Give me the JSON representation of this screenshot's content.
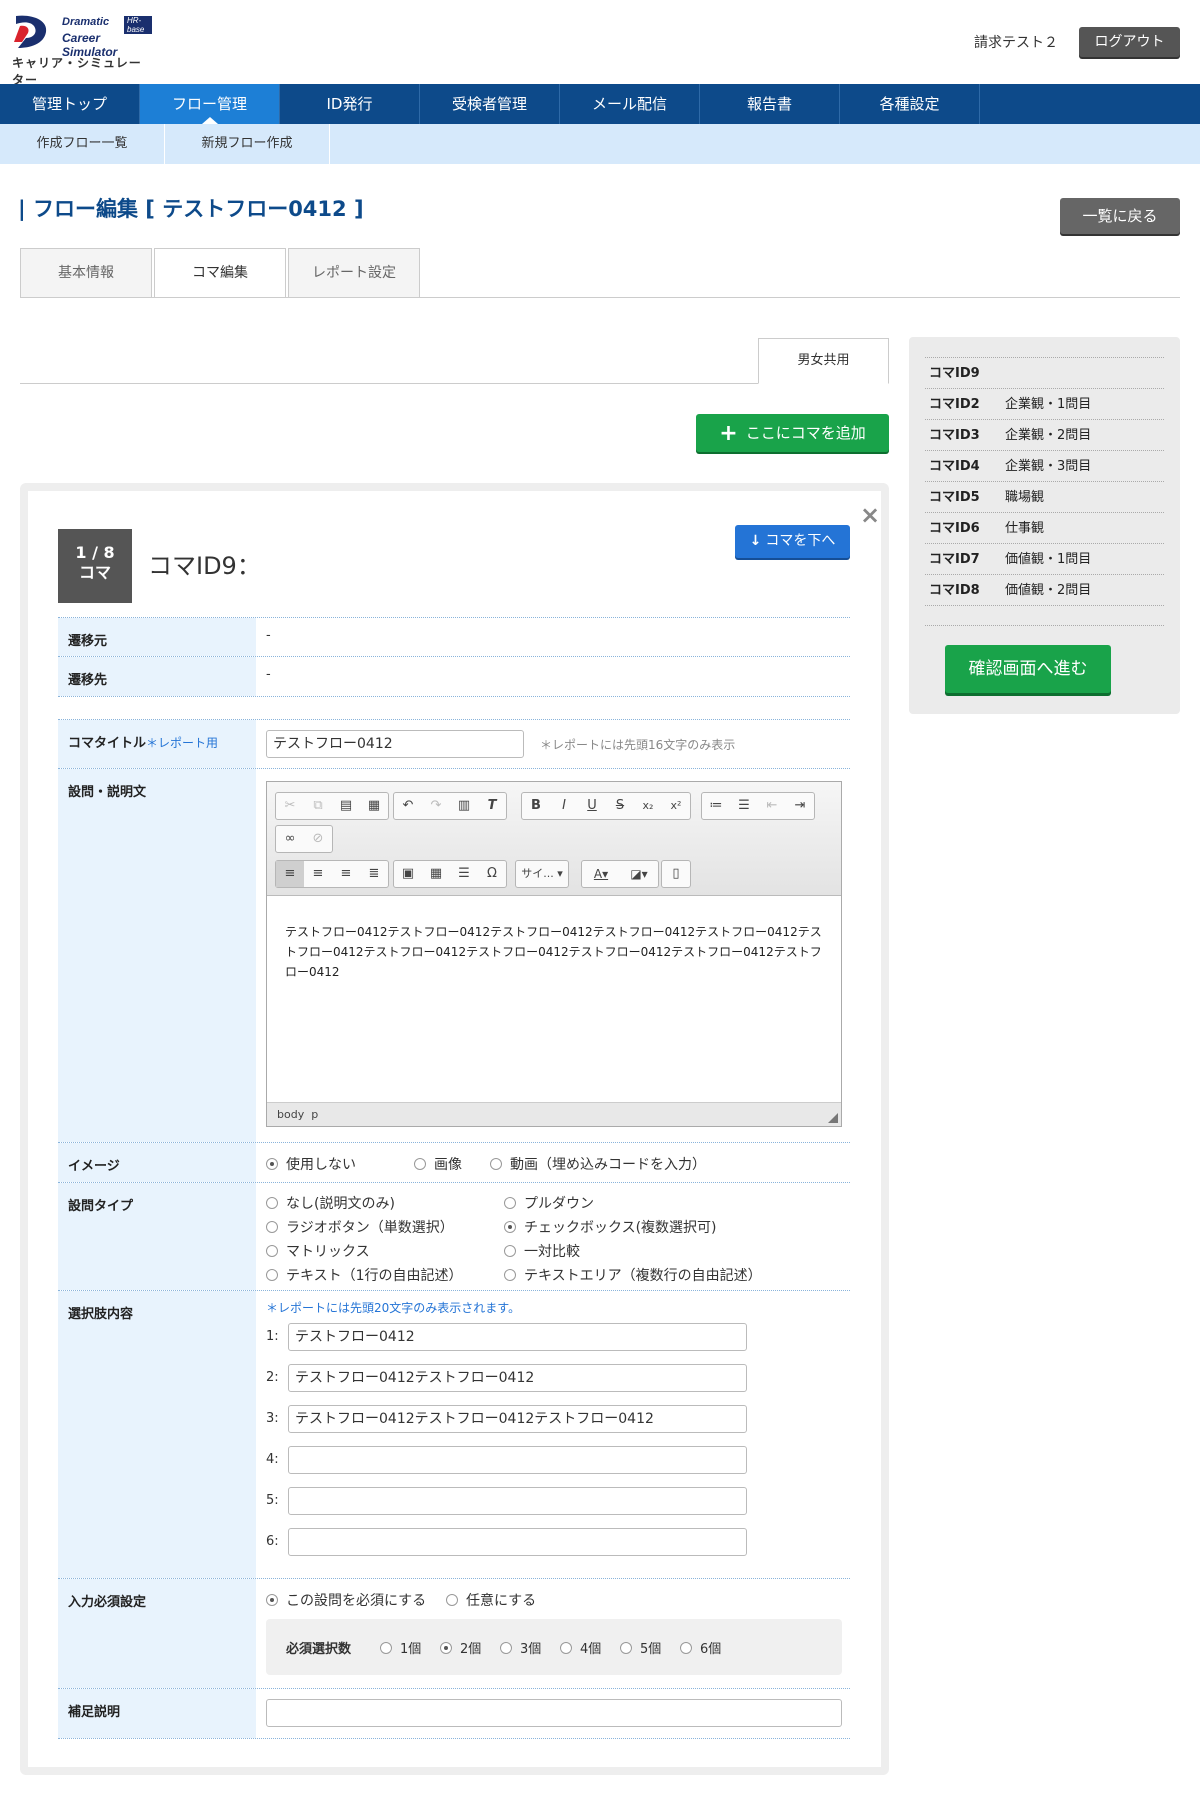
{
  "header": {
    "logo": {
      "line1": "Dramatic",
      "badge": "HR-base",
      "line2": "Career Simulator",
      "line3": "キャリア・シミュレーター"
    },
    "user_name": "請求テスト２",
    "logout": "ログアウト"
  },
  "nav": {
    "items": [
      "管理トップ",
      "フロー管理",
      "ID発行",
      "受検者管理",
      "メール配信",
      "報告書",
      "各種設定"
    ],
    "active_index": 1,
    "sub_items": [
      "作成フロー一覧",
      "新規フロー作成"
    ]
  },
  "page": {
    "title": "| フロー編集 [ テストフロー0412 ]",
    "back_button": "一覧に戻る"
  },
  "tabs": [
    "基本情報",
    "コマ編集",
    "レポート設定"
  ],
  "gender_tab": "男女共用",
  "add_button": "ここにコマを追加",
  "sidebar": {
    "items": [
      {
        "id": "コマID9",
        "label": ""
      },
      {
        "id": "コマID2",
        "label": "企業観・1問目"
      },
      {
        "id": "コマID3",
        "label": "企業観・2問目"
      },
      {
        "id": "コマID4",
        "label": "企業観・3問目"
      },
      {
        "id": "コマID5",
        "label": "職場観"
      },
      {
        "id": "コマID6",
        "label": "仕事観"
      },
      {
        "id": "コマID7",
        "label": "価値観・1問目"
      },
      {
        "id": "コマID8",
        "label": "価値観・2問目"
      }
    ],
    "confirm_button": "確認画面へ進む"
  },
  "card": {
    "close": "×",
    "badge_line1": "1 / 8",
    "badge_line2": "コマ",
    "title": "コマID9：",
    "move_down_button": "コマを下へ",
    "from_label": "遷移元",
    "from_value": "-",
    "to_label": "遷移先",
    "to_value": "-",
    "koma_title_label": "コマタイトル",
    "koma_title_note": "＊レポート用",
    "koma_title_value": "テストフロー0412",
    "koma_title_hint": "＊レポートには先頭16文字のみ表示",
    "question_label": "設問・説明文",
    "editor": {
      "content": "テストフロー0412テストフロー0412テストフロー0412テストフロー0412テストフロー0412テストフロー0412テストフロー0412テストフロー0412テストフロー0412テストフロー0412テストフロー0412",
      "size_select": "サイ...",
      "status_body": "body",
      "status_p": "p"
    },
    "image_label": "イメージ",
    "image_options": [
      "使用しない",
      "画像",
      "動画（埋め込みコードを入力）"
    ],
    "image_selected": 0,
    "qtype_label": "設問タイプ",
    "qtype_options": [
      "なし(説明文のみ)",
      "プルダウン",
      "ラジオボタン（単数選択）",
      "チェックボックス(複数選択可)",
      "マトリックス",
      "一対比較",
      "テキスト（1行の自由記述）",
      "テキストエリア（複数行の自由記述）"
    ],
    "qtype_selected": 3,
    "choices_label": "選択肢内容",
    "choices_hint": "＊レポートには先頭20文字のみ表示されます。",
    "choices": [
      {
        "num": "1:",
        "value": "テストフロー0412"
      },
      {
        "num": "2:",
        "value": "テストフロー0412テストフロー0412"
      },
      {
        "num": "3:",
        "value": "テストフロー0412テストフロー0412テストフロー0412"
      },
      {
        "num": "4:",
        "value": ""
      },
      {
        "num": "5:",
        "value": ""
      },
      {
        "num": "6:",
        "value": ""
      }
    ],
    "required_label": "入力必須設定",
    "required_options": [
      "この設問を必須にする",
      "任意にする"
    ],
    "required_selected": 0,
    "required_count_label": "必須選択数",
    "required_count_options": [
      "1個",
      "2個",
      "3個",
      "4個",
      "5個",
      "6個"
    ],
    "required_count_selected": 1,
    "supplement_label": "補足説明",
    "supplement_value": ""
  },
  "colors": {
    "nav": "#0d4a8a",
    "nav_active": "#1d7fd6",
    "subnav": "#d6e9fb",
    "green": "#19a34a",
    "blue_btn": "#2474d6"
  }
}
